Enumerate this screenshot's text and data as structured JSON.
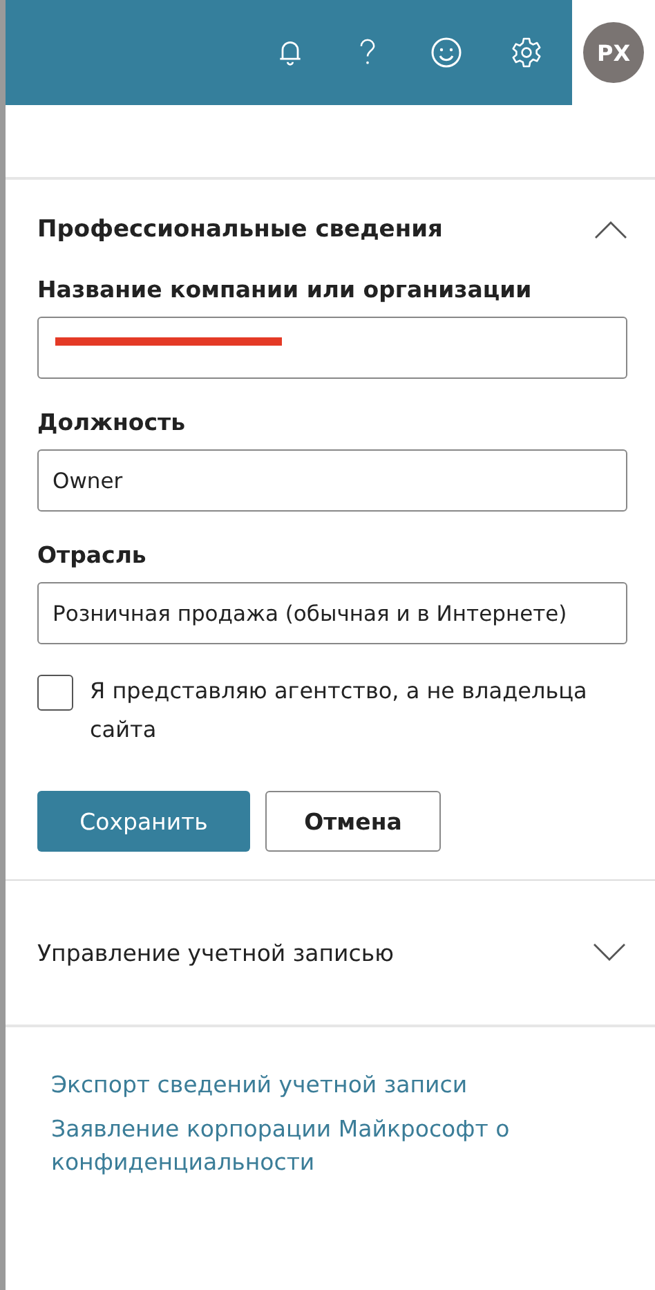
{
  "header": {
    "avatar": "PX"
  },
  "section": {
    "title": "Профессиональные сведения",
    "expanded": true,
    "fields": [
      {
        "kind": "text",
        "label": "Название компании или организации",
        "redacted": true
      },
      {
        "kind": "text",
        "label": "Должность",
        "value": "Owner"
      },
      {
        "kind": "select",
        "label": "Отрасль",
        "value": "Розничная продажа (обычная и в Интернете)"
      }
    ],
    "checkbox": {
      "label": "Я представляю агентство, а не владельца сайта",
      "checked": false
    },
    "buttons": [
      {
        "kind": "primary",
        "label": "Сохранить"
      },
      {
        "kind": "secondary",
        "label": "Отмена"
      }
    ]
  },
  "accordion": {
    "title": "Управление учетной записью",
    "expanded": false
  },
  "links": [
    "Экспорт сведений учетной записи",
    "Заявление корпорации Майкрософт о конфиденциальности"
  ]
}
